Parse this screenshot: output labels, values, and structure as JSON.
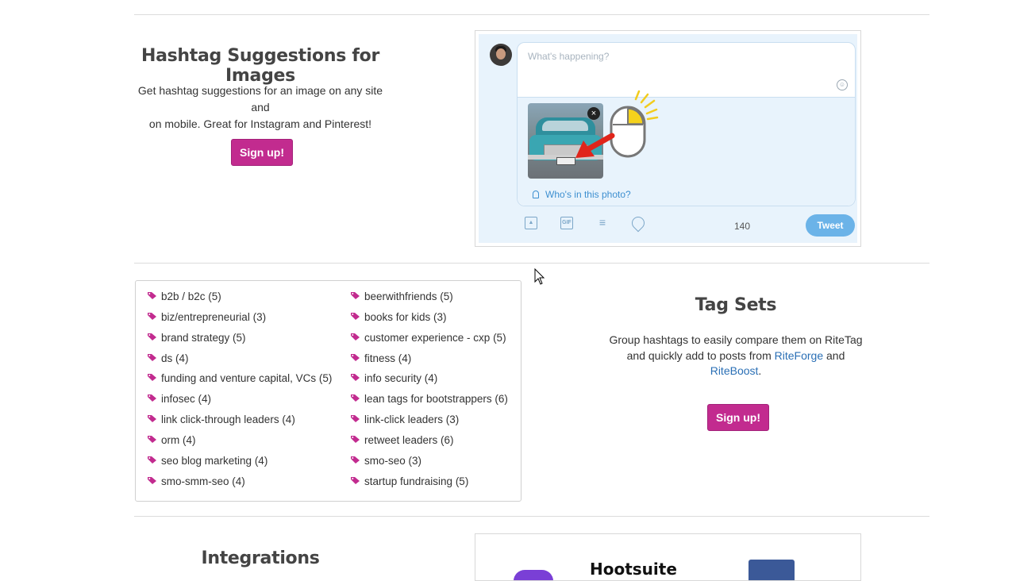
{
  "sections": {
    "images": {
      "title": "Hashtag Suggestions for Images",
      "description_line1": "Get hashtag suggestions for an image on any site and",
      "description_line2": "on mobile. Great for Instagram and Pinterest!",
      "signup_label": "Sign up!"
    },
    "tweet_mock": {
      "placeholder": "What's happening?",
      "who_label": "Who's in this photo?",
      "remove_label": "×",
      "gif_label": "GIF",
      "char_count": "140",
      "tweet_label": "Tweet"
    },
    "tag_sets": {
      "title": "Tag Sets",
      "desc_line1": "Group hashtags to easily compare them on RiteTag",
      "desc_line2_pre": "and quickly add to posts from ",
      "link1": "RiteForge",
      "desc_line2_mid": " and",
      "link2": "RiteBoost",
      "desc_end": ".",
      "signup_label": "Sign up!",
      "left_column": [
        "b2b / b2c (5)",
        "biz/entrepreneurial (3)",
        "brand strategy (5)",
        "ds (4)",
        "funding and venture capital, VCs (5)",
        "infosec (4)",
        "link click-through leaders (4)",
        "orm (4)",
        "seo blog marketing (4)",
        "smo-smm-seo (4)"
      ],
      "right_column": [
        "beerwithfriends (5)",
        "books for kids (3)",
        "customer experience - cxp (5)",
        "fitness (4)",
        "info security (4)",
        "lean tags for bootstrappers (6)",
        "link-click leaders (3)",
        "retweet leaders (6)",
        "smo-seo (3)",
        "startup fundraising (5)"
      ]
    },
    "integrations": {
      "title": "Integrations",
      "hootsuite_label": "Hootsuite"
    }
  },
  "colors": {
    "accent": "#c22b8f",
    "link": "#2a6fb5",
    "tweet_blue": "#6bb3e8"
  },
  "icons": {
    "tag": "tag-icon",
    "image": "image-icon",
    "gif": "gif-icon",
    "poll": "poll-icon",
    "location": "location-icon",
    "emoji": "emoji-icon",
    "person": "person-icon",
    "mouse": "mouse-click-icon",
    "arrow": "red-arrow-icon"
  }
}
